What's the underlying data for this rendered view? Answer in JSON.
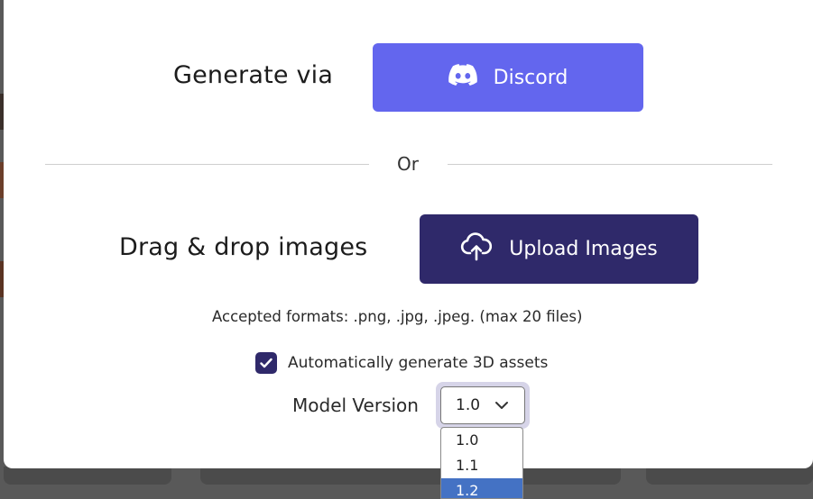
{
  "colors": {
    "discord": "#6366ee",
    "upload": "#2f296a",
    "checkbox": "#2f296a",
    "option_highlight": "#4472c4"
  },
  "generate": {
    "label": "Generate via",
    "discord_button": "Discord",
    "discord_icon": "discord-icon"
  },
  "divider": {
    "text": "Or"
  },
  "upload": {
    "label": "Drag & drop images",
    "button": "Upload Images",
    "icon": "cloud-upload-icon",
    "formats": "Accepted formats: .png, .jpg, .jpeg. (max 20 files)"
  },
  "auto_generate": {
    "checked": true,
    "label": "Automatically generate 3D assets"
  },
  "model_version": {
    "label": "Model Version",
    "selected": "1.0",
    "options": [
      "1.0",
      "1.1",
      "1.2"
    ],
    "highlighted": "1.2"
  }
}
